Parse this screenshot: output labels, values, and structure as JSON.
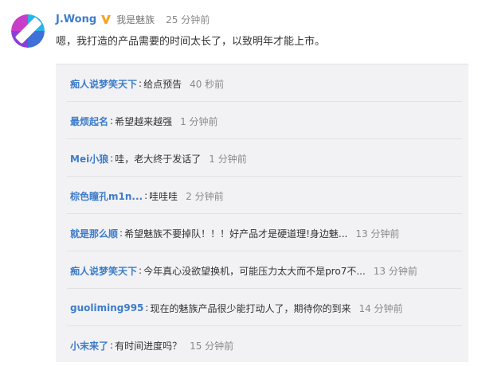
{
  "post": {
    "author": "J.Wong",
    "author_desc": "我是魅族",
    "time": "25 分钟前",
    "text": "嗯，我打造的产品需要的时间太长了，以致明年才能上市。",
    "avatar_icon": "meizu-avatar-icon",
    "verified_icon": "verified-v-icon"
  },
  "comments": [
    {
      "user": "痴人说梦笑天下",
      "sep": ":",
      "text": "给点预告",
      "time": "40 秒前"
    },
    {
      "user": "最烦起名",
      "sep": ":",
      "text": "希望越来越强",
      "time": "1 分钟前"
    },
    {
      "user": "Mei小狼",
      "sep": ":",
      "text": "哇，老大终于发话了",
      "time": "1 分钟前"
    },
    {
      "user": "棕色瞳孔m1n...",
      "sep": ":",
      "text": "哇哇哇",
      "time": "2 分钟前"
    },
    {
      "user": "就是那么顺",
      "sep": ":",
      "text": "希望魅族不要掉队！！！好产品才是硬道理!身边魅...",
      "time": "13 分钟前"
    },
    {
      "user": "痴人说梦笑天下",
      "sep": ":",
      "text": "今年真心没欲望换机，可能压力太大而不是pro7不...",
      "time": "13 分钟前"
    },
    {
      "user": "guoliming995",
      "sep": ":",
      "text": "现在的魅族产品很少能打动人了，期待你的到来",
      "time": "14 分钟前"
    },
    {
      "user": "小末来了",
      "sep": ":",
      "text": "有时间进度吗？",
      "time": "15 分钟前"
    }
  ],
  "colors": {
    "link": "#3d7cc9",
    "text": "#333333",
    "muted": "#8a8a8a",
    "panel": "#f2f2f5"
  }
}
